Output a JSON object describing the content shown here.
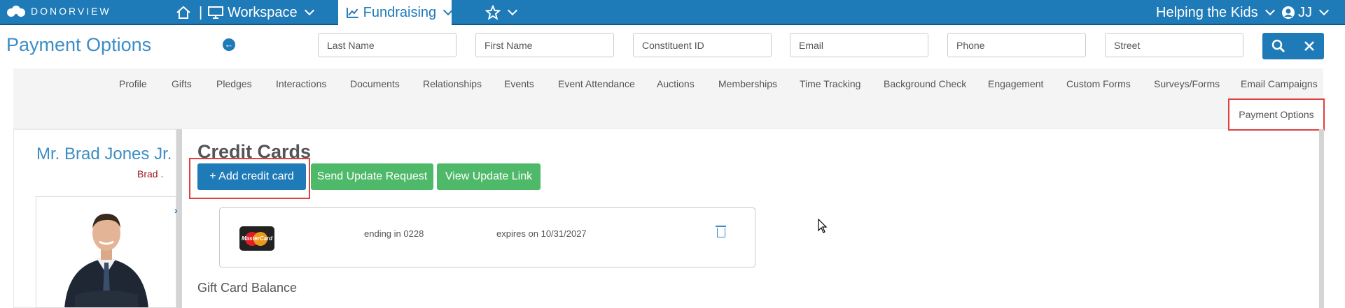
{
  "topbar": {
    "logo_text": "DONORVIEW",
    "workspace_label": "Workspace",
    "fundraising_label": "Fundraising",
    "org_label": "Helping the Kids",
    "user_label": "JJ"
  },
  "page": {
    "title": "Payment Options"
  },
  "search": {
    "fields": [
      {
        "placeholder": "Last Name"
      },
      {
        "placeholder": "First Name"
      },
      {
        "placeholder": "Constituent ID"
      },
      {
        "placeholder": "Email"
      },
      {
        "placeholder": "Phone"
      },
      {
        "placeholder": "Street"
      }
    ]
  },
  "subtabs": [
    "Profile",
    "Gifts",
    "Pledges",
    "Interactions",
    "Documents",
    "Relationships",
    "Events",
    "Event Attendance",
    "Auctions",
    "Memberships",
    "Time Tracking",
    "Background Check",
    "Engagement",
    "Custom Forms",
    "Surveys/Forms",
    "Email Campaigns"
  ],
  "active_subtab": "Payment Options",
  "donor": {
    "name": "Mr. Brad Jones Jr.",
    "short_name": "Brad ."
  },
  "credit_cards": {
    "title": "Credit Cards",
    "add_button": "+ Add credit card",
    "send_update_button": "Send Update Request",
    "view_link_button": "View Update Link",
    "card": {
      "brand": "MasterCard",
      "ending": "ending in 0228",
      "expires": "expires on 10/31/2027"
    }
  },
  "gift_card": {
    "title": "Gift Card Balance"
  },
  "colors": {
    "primary": "#1f7ab8",
    "accent_green": "#4fb96a",
    "title_blue": "#3c8dc5",
    "highlight": "#e04040"
  }
}
